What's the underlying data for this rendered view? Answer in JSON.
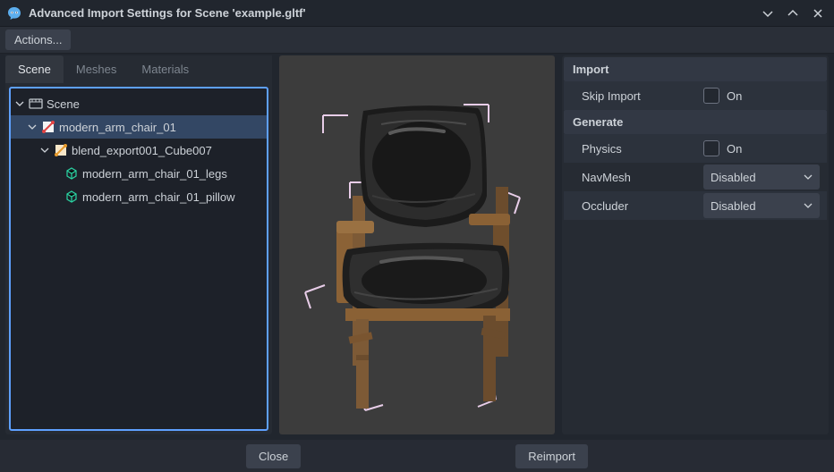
{
  "window": {
    "title": "Advanced Import Settings for Scene 'example.gltf'"
  },
  "toolbar": {
    "actions_label": "Actions..."
  },
  "tabs": {
    "items": [
      "Scene",
      "Meshes",
      "Materials"
    ],
    "active": 0
  },
  "tree": {
    "nodes": [
      {
        "label": "Scene",
        "indent": 0,
        "expanded": true,
        "icon": "movie",
        "selected": false
      },
      {
        "label": "modern_arm_chair_01",
        "indent": 1,
        "expanded": true,
        "icon": "node3d-red",
        "selected": true
      },
      {
        "label": "blend_export001_Cube007",
        "indent": 2,
        "expanded": true,
        "icon": "node3d-orange",
        "selected": false
      },
      {
        "label": "modern_arm_chair_01_legs",
        "indent": 3,
        "expanded": false,
        "icon": "cube",
        "selected": false,
        "leaf": true
      },
      {
        "label": "modern_arm_chair_01_pillow",
        "indent": 3,
        "expanded": false,
        "icon": "cube",
        "selected": false,
        "leaf": true
      }
    ]
  },
  "inspector": {
    "sections": {
      "import_header": "Import",
      "generate_header": "Generate"
    },
    "skip_import": {
      "label": "Skip Import",
      "value": "On"
    },
    "physics": {
      "label": "Physics",
      "value": "On"
    },
    "navmesh": {
      "label": "NavMesh",
      "value": "Disabled"
    },
    "occluder": {
      "label": "Occluder",
      "value": "Disabled"
    }
  },
  "footer": {
    "close_label": "Close",
    "reimport_label": "Reimport"
  }
}
